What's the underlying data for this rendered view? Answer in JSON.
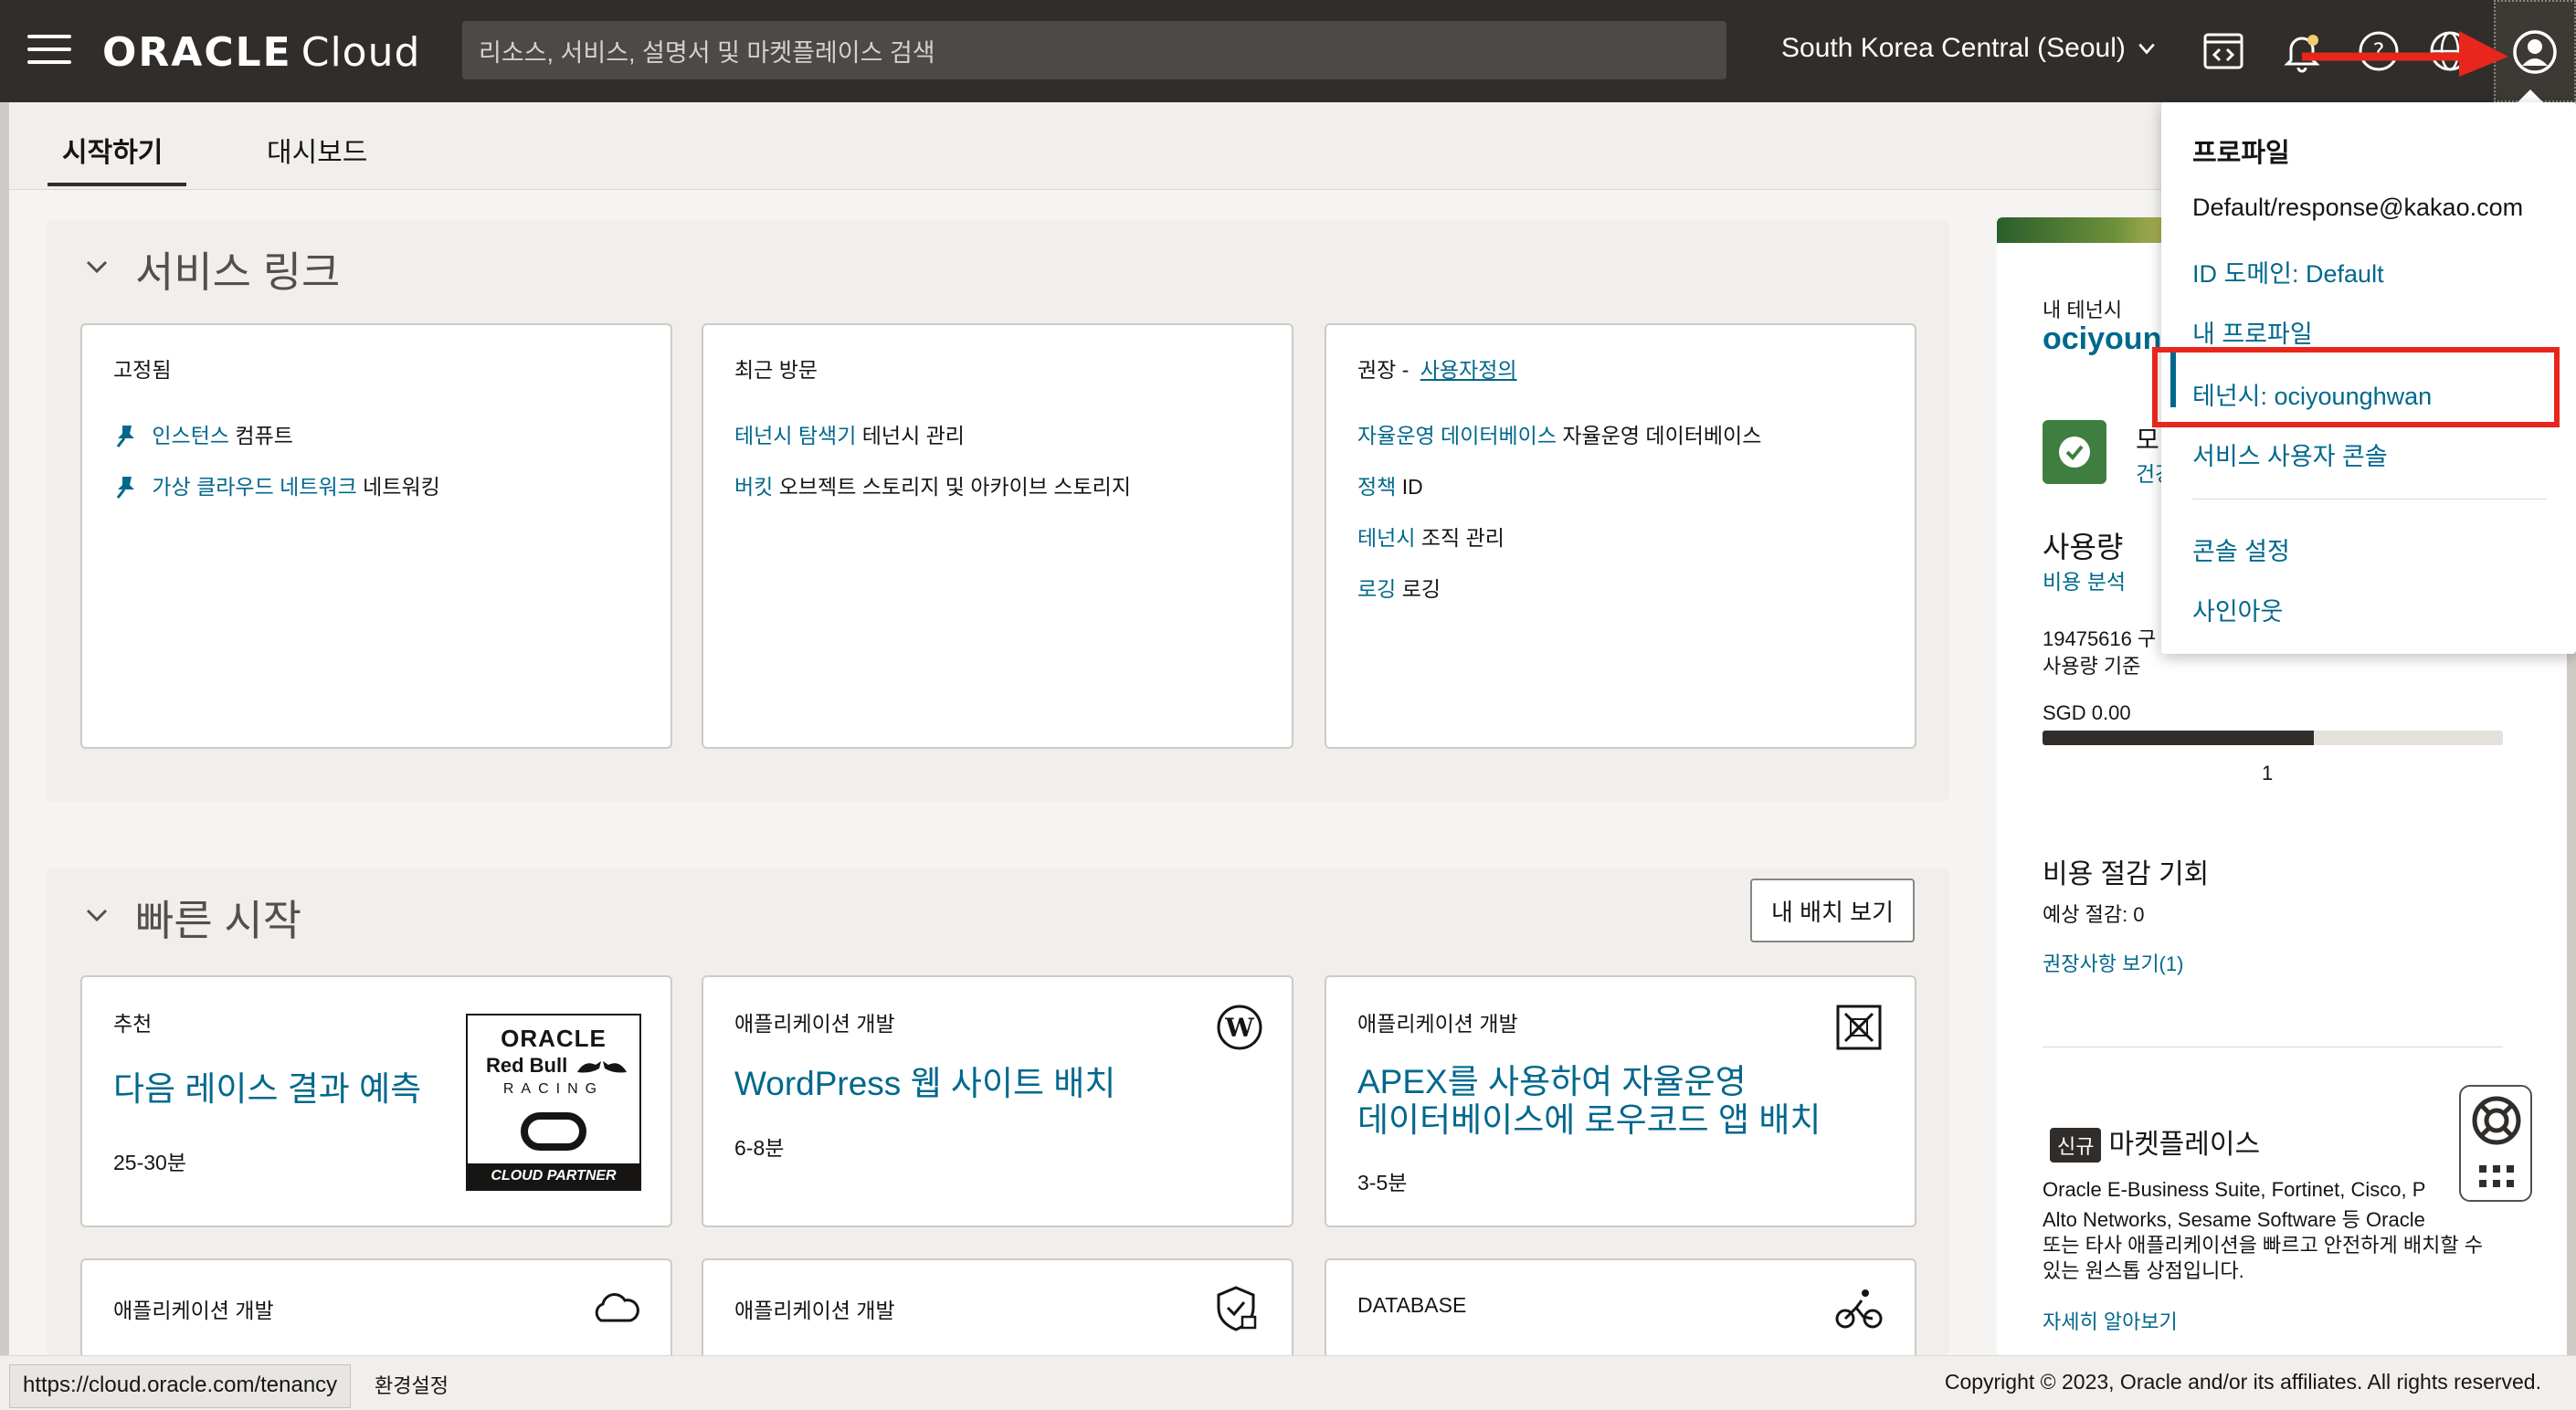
{
  "topbar": {
    "logo_brand": "ORACLE",
    "logo_product": "Cloud",
    "search_placeholder": "리소스, 서비스, 설명서 및 마켓플레이스 검색",
    "region": "South Korea Central (Seoul)"
  },
  "tabs": [
    {
      "label": "시작하기",
      "active": true
    },
    {
      "label": "대시보드",
      "active": false
    }
  ],
  "service_links": {
    "title": "서비스 링크",
    "pinned": {
      "heading": "고정됨",
      "items": [
        {
          "link": "인스턴스",
          "text": "컴퓨트"
        },
        {
          "link": "가상 클라우드 네트워크",
          "text": "네트워킹"
        }
      ]
    },
    "recent": {
      "heading": "최근 방문",
      "items": [
        {
          "link": "테넌시 탐색기",
          "text": "테넌시 관리"
        },
        {
          "link": "버킷",
          "text": "오브젝트 스토리지 및 아카이브 스토리지"
        }
      ]
    },
    "recommended": {
      "heading": "권장 -",
      "customize": "사용자정의",
      "items": [
        {
          "link": "자율운영 데이터베이스",
          "text": "자율운영 데이터베이스"
        },
        {
          "link": "정책",
          "text": "ID"
        },
        {
          "link": "테넌시",
          "text": "조직 관리"
        },
        {
          "link": "로깅",
          "text": "로깅"
        }
      ]
    }
  },
  "quick_start": {
    "title": "빠른 시작",
    "deploy_button": "내 배치 보기",
    "cards": [
      {
        "category": "추천",
        "title": "다음 레이스 결과 예측",
        "time": "25-30분",
        "icon": "oracle-redbull-racing-logo"
      },
      {
        "category": "애플리케이션 개발",
        "title": "WordPress 웹 사이트 배치",
        "time": "6-8분",
        "icon": "wordpress-icon"
      },
      {
        "category": "애플리케이션 개발",
        "title": "APEX를 사용하여 자율운영 데이터베이스에 로우코드 앱 배치",
        "title_line1": "APEX를 사용하여 자율운영",
        "title_line2": "데이터베이스에 로우코드 앱 배치",
        "time": "3-5분",
        "icon": "apex-icon"
      },
      {
        "category": "애플리케이션 개발",
        "icon": "cloud-icon"
      },
      {
        "category": "애플리케이션 개발",
        "icon": "shield-lock-icon"
      },
      {
        "category": "DATABASE",
        "icon": "cyclist-icon"
      }
    ],
    "redbull_logo": {
      "line1": "ORACLE",
      "line2": "Red Bull",
      "line3": "RACING",
      "line4": "CLOUD PARTNER"
    }
  },
  "right_column": {
    "tenancy_label": "내 테넌시",
    "tenancy_name": "ociyoun",
    "status_heading": "모",
    "status_link": "건강",
    "usage_heading": "사용량",
    "cost_analysis_link": "비용 분석",
    "usage_line1": "19475616 구",
    "usage_line2": "사용량 기준",
    "cost_value": "SGD 0.00",
    "progress_fraction": 0.59,
    "progress_label": "1",
    "savings_heading": "비용 절감 기회",
    "savings_estimate": "예상 절감: 0",
    "recommendations_link": "권장사항 보기(1)",
    "new_badge": "신규",
    "marketplace_heading": "마켓플레이스",
    "marketplace_line1": "Oracle E-Business Suite, Fortinet, Cisco, P",
    "marketplace_line2": "Alto Networks, Sesame Software 등 Oracle",
    "marketplace_line3": "또는 타사 애플리케이션을 빠르고 안전하게 배치할 수",
    "marketplace_line4": "있는 원스톱 상점입니다.",
    "learn_more": "자세히 알아보기"
  },
  "profile_menu": {
    "title": "프로파일",
    "user": "Default/response@kakao.com",
    "id_domain": "ID 도메인: Default",
    "my_profile": "내 프로파일",
    "tenancy": "테넌시: ociyounghwan",
    "service_user_console": "서비스 사용자 콘솔",
    "console_settings": "콘솔 설정",
    "sign_out": "사인아웃"
  },
  "footer": {
    "status_url": "https://cloud.oracle.com/tenancy",
    "left_text": "환경설정",
    "copyright": "Copyright © 2023, Oracle and/or its affiliates. All rights reserved."
  },
  "colors": {
    "topbar": "#312d2a",
    "link": "#00688c",
    "highlight_box": "#e8261c",
    "red_arrow": "#e8261c"
  }
}
